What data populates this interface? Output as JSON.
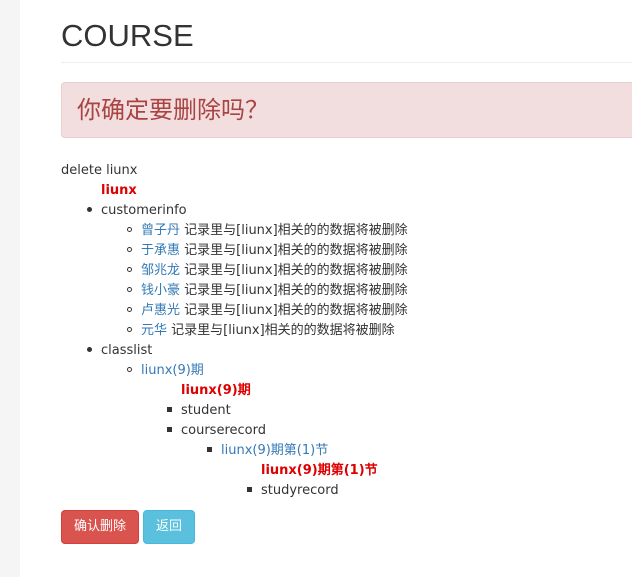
{
  "header": {
    "title": "COURSE"
  },
  "alert": {
    "message": "你确定要删除吗？"
  },
  "tree": {
    "delete_label": "delete liunx",
    "root_name": "liunx",
    "customerinfo": {
      "label": "customerinfo",
      "suffix": " 记录里与[liunx]相关的的数据将被删除",
      "customers": [
        "曾子丹",
        "于承惠",
        "邹兆龙",
        "钱小豪",
        "卢惠光",
        "元华"
      ]
    },
    "classlist": {
      "label": "classlist",
      "class_link": "liunx(9)期",
      "class_name": "liunx(9)期",
      "student": "student",
      "courserecord": "courserecord",
      "record_link": "liunx(9)期第(1)节",
      "record_name": "liunx(9)期第(1)节",
      "studyrecord": "studyrecord"
    }
  },
  "buttons": {
    "confirm_delete": "确认删除",
    "back": "返回"
  },
  "colors": {
    "alert_bg": "#f2dede",
    "alert_text": "#a94442",
    "link": "#337ab7",
    "danger": "#d9534f",
    "info": "#5bc0de",
    "strong_red": "#dd0000"
  }
}
